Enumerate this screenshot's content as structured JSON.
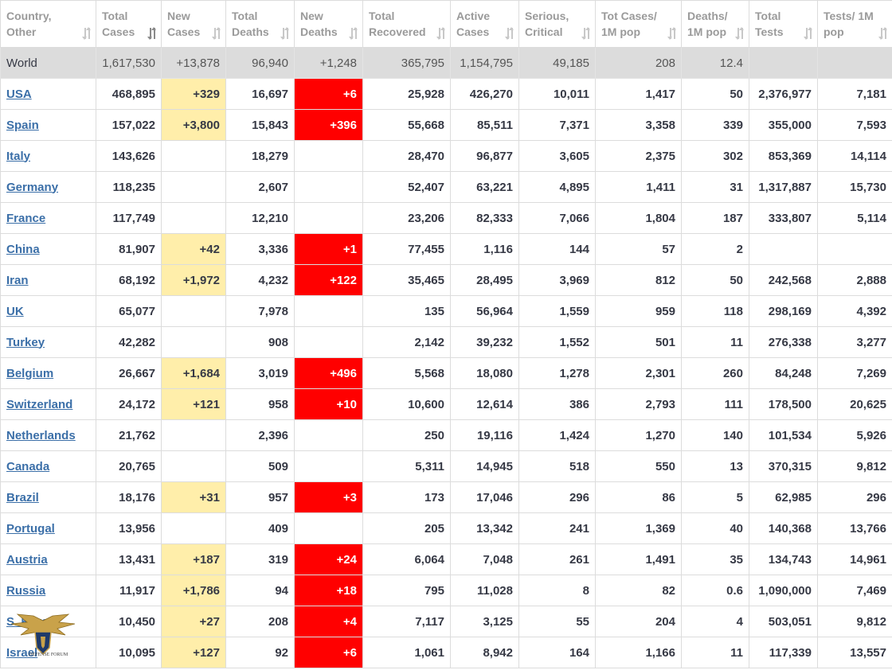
{
  "headers": [
    {
      "label": "Country, Other"
    },
    {
      "label": "Total Cases",
      "sorted": true
    },
    {
      "label": "New Cases"
    },
    {
      "label": "Total Deaths"
    },
    {
      "label": "New Deaths"
    },
    {
      "label": "Total Recovered"
    },
    {
      "label": "Active Cases"
    },
    {
      "label": "Serious, Critical"
    },
    {
      "label": "Tot Cases/ 1M pop"
    },
    {
      "label": "Deaths/ 1M pop"
    },
    {
      "label": "Total Tests"
    },
    {
      "label": "Tests/ 1M pop"
    }
  ],
  "world": [
    "World",
    "1,617,530",
    "+13,878",
    "96,940",
    "+1,248",
    "365,795",
    "1,154,795",
    "49,185",
    "208",
    "12.4",
    "",
    ""
  ],
  "rows": [
    [
      "USA",
      "468,895",
      "+329",
      "16,697",
      "+6",
      "25,928",
      "426,270",
      "10,011",
      "1,417",
      "50",
      "2,376,977",
      "7,181"
    ],
    [
      "Spain",
      "157,022",
      "+3,800",
      "15,843",
      "+396",
      "55,668",
      "85,511",
      "7,371",
      "3,358",
      "339",
      "355,000",
      "7,593"
    ],
    [
      "Italy",
      "143,626",
      "",
      "18,279",
      "",
      "28,470",
      "96,877",
      "3,605",
      "2,375",
      "302",
      "853,369",
      "14,114"
    ],
    [
      "Germany",
      "118,235",
      "",
      "2,607",
      "",
      "52,407",
      "63,221",
      "4,895",
      "1,411",
      "31",
      "1,317,887",
      "15,730"
    ],
    [
      "France",
      "117,749",
      "",
      "12,210",
      "",
      "23,206",
      "82,333",
      "7,066",
      "1,804",
      "187",
      "333,807",
      "5,114"
    ],
    [
      "China",
      "81,907",
      "+42",
      "3,336",
      "+1",
      "77,455",
      "1,116",
      "144",
      "57",
      "2",
      "",
      ""
    ],
    [
      "Iran",
      "68,192",
      "+1,972",
      "4,232",
      "+122",
      "35,465",
      "28,495",
      "3,969",
      "812",
      "50",
      "242,568",
      "2,888"
    ],
    [
      "UK",
      "65,077",
      "",
      "7,978",
      "",
      "135",
      "56,964",
      "1,559",
      "959",
      "118",
      "298,169",
      "4,392"
    ],
    [
      "Turkey",
      "42,282",
      "",
      "908",
      "",
      "2,142",
      "39,232",
      "1,552",
      "501",
      "11",
      "276,338",
      "3,277"
    ],
    [
      "Belgium",
      "26,667",
      "+1,684",
      "3,019",
      "+496",
      "5,568",
      "18,080",
      "1,278",
      "2,301",
      "260",
      "84,248",
      "7,269"
    ],
    [
      "Switzerland",
      "24,172",
      "+121",
      "958",
      "+10",
      "10,600",
      "12,614",
      "386",
      "2,793",
      "111",
      "178,500",
      "20,625"
    ],
    [
      "Netherlands",
      "21,762",
      "",
      "2,396",
      "",
      "250",
      "19,116",
      "1,424",
      "1,270",
      "140",
      "101,534",
      "5,926"
    ],
    [
      "Canada",
      "20,765",
      "",
      "509",
      "",
      "5,311",
      "14,945",
      "518",
      "550",
      "13",
      "370,315",
      "9,812"
    ],
    [
      "Brazil",
      "18,176",
      "+31",
      "957",
      "+3",
      "173",
      "17,046",
      "296",
      "86",
      "5",
      "62,985",
      "296"
    ],
    [
      "Portugal",
      "13,956",
      "",
      "409",
      "",
      "205",
      "13,342",
      "241",
      "1,369",
      "40",
      "140,368",
      "13,766"
    ],
    [
      "Austria",
      "13,431",
      "+187",
      "319",
      "+24",
      "6,064",
      "7,048",
      "261",
      "1,491",
      "35",
      "134,743",
      "14,961"
    ],
    [
      "Russia",
      "11,917",
      "+1,786",
      "94",
      "+18",
      "795",
      "11,028",
      "8",
      "82",
      "0.6",
      "1,090,000",
      "7,469"
    ],
    [
      "S. Korea",
      "10,450",
      "+27",
      "208",
      "+4",
      "7,117",
      "3,125",
      "55",
      "204",
      "4",
      "503,051",
      "9,812"
    ],
    [
      "Israel",
      "10,095",
      "+127",
      "92",
      "+6",
      "1,061",
      "8,942",
      "164",
      "1,166",
      "11",
      "117,339",
      "13,557"
    ]
  ],
  "colors": {
    "new_cases_bg": "#ffeeaa",
    "new_deaths_bg": "#ff0000",
    "link": "#3b6fa8",
    "world_row_bg": "#dcdcdc"
  },
  "watermark": {
    "text": "DEFENSE FORUM",
    "icon": "eagle-emblem-icon"
  }
}
